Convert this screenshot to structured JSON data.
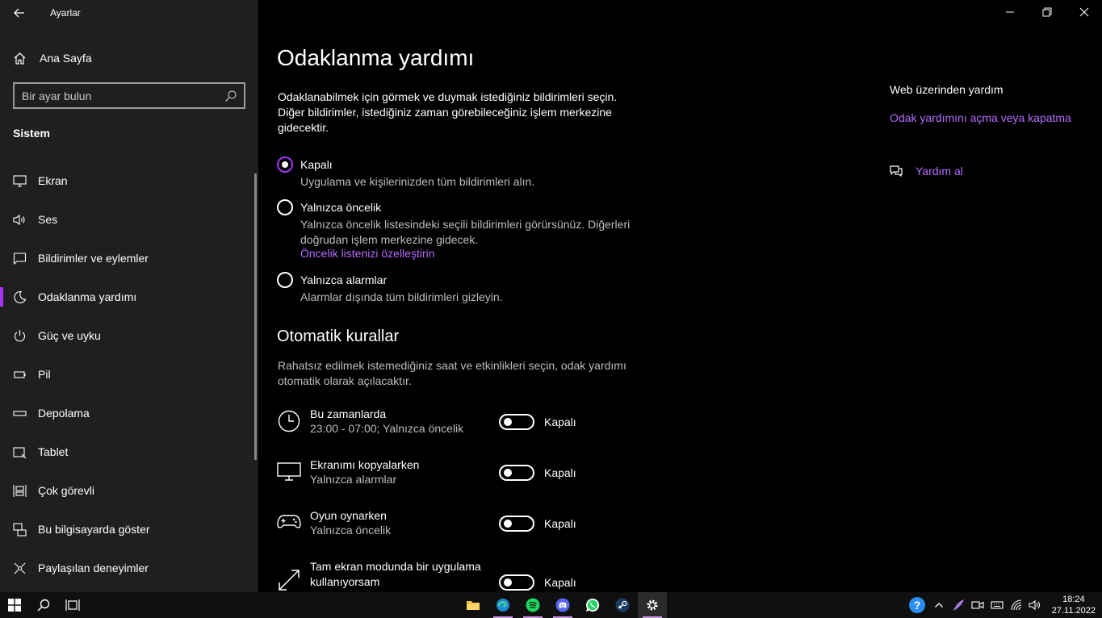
{
  "window": {
    "title": "Ayarlar",
    "controls": [
      "minimize",
      "restore",
      "close"
    ]
  },
  "sidebar": {
    "home_label": "Ana Sayfa",
    "search_placeholder": "Bir ayar bulun",
    "section": "Sistem",
    "items": [
      {
        "label": "Ekran",
        "icon": "monitor-icon"
      },
      {
        "label": "Ses",
        "icon": "speaker-icon"
      },
      {
        "label": "Bildirimler ve eylemler",
        "icon": "message-icon"
      },
      {
        "label": "Odaklanma yardımı",
        "icon": "moon-icon",
        "active": true
      },
      {
        "label": "Güç ve uyku",
        "icon": "power-icon"
      },
      {
        "label": "Pil",
        "icon": "battery-icon"
      },
      {
        "label": "Depolama",
        "icon": "storage-icon"
      },
      {
        "label": "Tablet",
        "icon": "tablet-icon"
      },
      {
        "label": "Çok görevli",
        "icon": "multitask-icon"
      },
      {
        "label": "Bu bilgisayarda göster",
        "icon": "project-icon"
      },
      {
        "label": "Paylaşılan deneyimler",
        "icon": "shared-icon"
      }
    ]
  },
  "main": {
    "title": "Odaklanma yardımı",
    "intro": "Odaklanabilmek için görmek ve duymak istediğiniz bildirimleri seçin. Diğer bildirimler, istediğiniz zaman görebileceğiniz işlem merkezine gidecektir.",
    "options": [
      {
        "title": "Kapalı",
        "desc": "Uygulama ve kişilerinizden tüm bildirimleri alın.",
        "checked": true
      },
      {
        "title": "Yalnızca öncelik",
        "desc": "Yalnızca öncelik listesindeki seçili bildirimleri görürsünüz. Diğerleri doğrudan işlem merkezine gidecek.",
        "link": "Öncelik listenizi özelleştirin",
        "checked": false
      },
      {
        "title": "Yalnızca alarmlar",
        "desc": "Alarmlar dışında tüm bildirimleri gizleyin.",
        "checked": false
      }
    ],
    "auto_rules_title": "Otomatik kurallar",
    "auto_rules_desc": "Rahatsız edilmek istemediğiniz saat ve etkinlikleri seçin, odak yardımı otomatik olarak açılacaktır.",
    "rules": [
      {
        "title": "Bu zamanlarda",
        "sub": "23:00 - 07:00; Yalnızca öncelik",
        "state": "Kapalı",
        "icon": "clock-icon"
      },
      {
        "title": "Ekranımı kopyalarken",
        "sub": "Yalnızca alarmlar",
        "state": "Kapalı",
        "icon": "monitor-icon"
      },
      {
        "title": "Oyun oynarken",
        "sub": "Yalnızca öncelik",
        "state": "Kapalı",
        "icon": "gamepad-icon"
      },
      {
        "title": "Tam ekran modunda bir uygulama kullanıyorsam",
        "sub": "",
        "state": "Kapalı",
        "icon": "fullscreen-icon"
      }
    ]
  },
  "help": {
    "title": "Web üzerinden yardım",
    "link": "Odak yardımını açma veya kapatma",
    "get_help": "Yardım al"
  },
  "taskbar": {
    "time": "18:24",
    "date": "27.11.2022",
    "accent": "#a336f4"
  }
}
